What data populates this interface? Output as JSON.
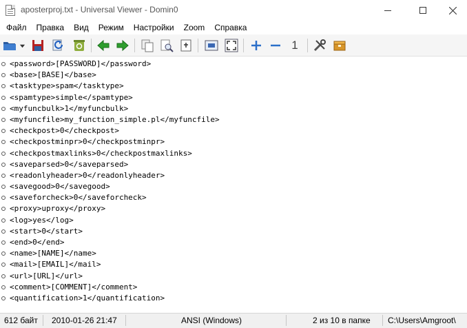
{
  "window": {
    "title": "aposterproj.txt - Universal Viewer - Domin0"
  },
  "menu": [
    "Файл",
    "Правка",
    "Вид",
    "Режим",
    "Настройки",
    "Zoom",
    "Справка"
  ],
  "toolbar": {
    "icons": [
      "open-folder-icon",
      "dropdown-arrow-icon",
      "save-icon",
      "reload-icon",
      "recycle-icon",
      "back-arrow-icon",
      "forward-arrow-icon",
      "copy-icon",
      "print-preview-icon",
      "export-icon",
      "fit-window-icon",
      "fullscreen-icon",
      "zoom-in-icon",
      "zoom-out-icon",
      "original-size-icon",
      "settings-tools-icon",
      "plugins-box-icon"
    ],
    "original_size_label": "1",
    "colors": {
      "arrows": "#2e9e2e",
      "plus_minus": "#2b6fc9"
    }
  },
  "content": {
    "lines": [
      "<password>[PASSWORD]</password>",
      "<base>[BASE]</base>",
      "<tasktype>spam</tasktype>",
      "<spamtype>simple</spamtype>",
      "<myfuncbulk>1</myfuncbulk>",
      "<myfuncfile>my_function_simple.pl</myfuncfile>",
      "<checkpost>0</checkpost>",
      "<checkpostminpr>0</checkpostminpr>",
      "<checkpostmaxlinks>0</checkpostmaxlinks>",
      "<saveparsed>0</saveparsed>",
      "<readonlyheader>0</readonlyheader>",
      "<savegood>0</savegood>",
      "<saveforcheck>0</saveforcheck>",
      "<proxy>uproxy</proxy>",
      "<log>yes</log>",
      "<start>0</start>",
      "<end>0</end>",
      "<name>[NAME]</name>",
      "<mail>[EMAIL]</mail>",
      "<url>[URL]</url>",
      "<comment>[COMMENT]</comment>",
      "<quantification>1</quantification>"
    ]
  },
  "status": {
    "size": "612 байт",
    "date": "2010-01-26 21:47",
    "encoding": "ANSI (Windows)",
    "position": "2 из 10 в папке",
    "path": "C:\\Users\\Amgroot\\"
  }
}
